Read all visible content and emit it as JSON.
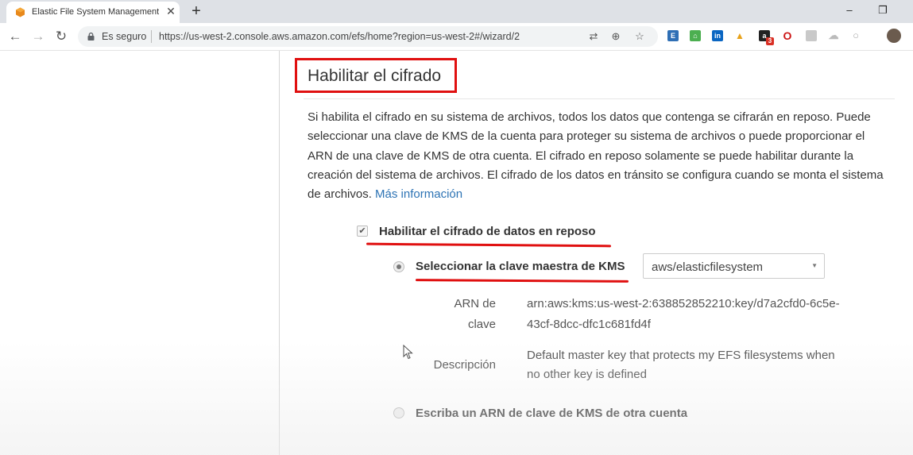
{
  "browser": {
    "tab_title": "Elastic File System Management C",
    "tab_close": "✕",
    "new_tab": "+",
    "window_minimize": "–",
    "window_restore": "❐",
    "security_label": "Es seguro",
    "url": "https://us-west-2.console.aws.amazon.com/efs/home?region=us-west-2#/wizard/2",
    "extension_badge": "3"
  },
  "section": {
    "title": "Habilitar el cifrado",
    "description": "Si habilita el cifrado en su sistema de archivos, todos los datos que contenga se cifrarán en reposo. Puede seleccionar una clave de KMS de la cuenta para proteger su sistema de archivos o puede proporcionar el ARN de una clave de KMS de otra cuenta. El cifrado en reposo solamente se puede habilitar durante la creación del sistema de archivos. El cifrado de los datos en tránsito se configura cuando se monta el sistema de archivos.",
    "more_info_link": "Más información"
  },
  "encryption": {
    "enable_label": "Habilitar el cifrado de datos en reposo",
    "enable_checked": true,
    "option_kms_label": "Seleccionar la clave maestra de KMS",
    "option_kms_selected": true,
    "kms_key_value": "aws/elasticfilesystem",
    "arn_label_line1": "ARN de",
    "arn_label_line2": "clave",
    "arn_value_line1": "arn:aws:kms:us-west-2:638852852210:key/d7a2cfd0-6c5e-",
    "arn_value_line2": "43cf-8dcc-dfc1c681fd4f",
    "description_label": "Descripción",
    "description_value_line1": "Default master key that protects my EFS filesystems when",
    "description_value_line2": "no other key is defined",
    "option_other_label": "Escriba un ARN de clave de KMS de otra cuenta",
    "option_other_selected": false
  }
}
